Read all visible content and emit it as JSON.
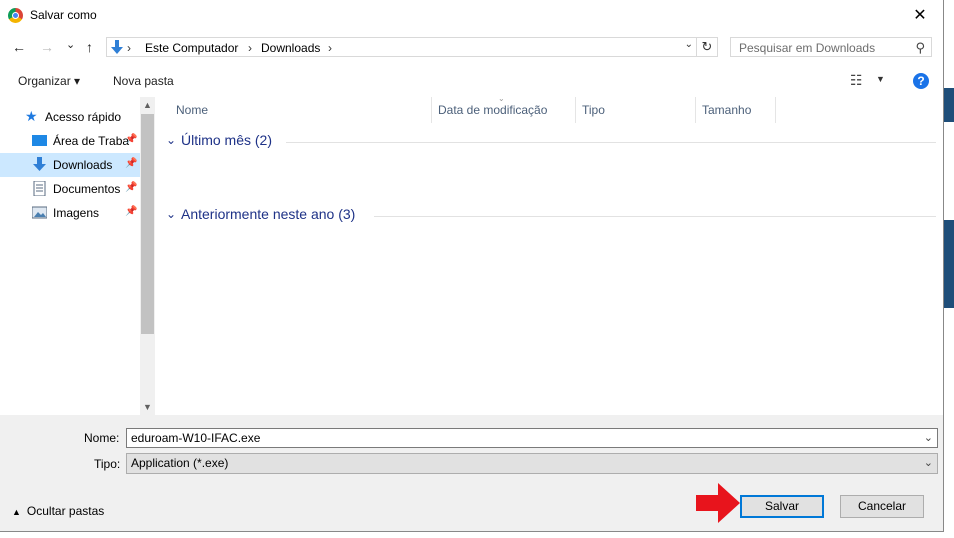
{
  "window": {
    "title": "Salvar como",
    "close_glyph": "✕"
  },
  "nav": {
    "back": "←",
    "forward": "→",
    "recent": "⌄",
    "up": "↑",
    "breadcrumbs": [
      "Este Computador",
      "Downloads"
    ],
    "separator": "›",
    "refresh": "↻",
    "search_placeholder": "Pesquisar em Downloads"
  },
  "toolbar": {
    "organize": "Organizar ▾",
    "new_folder": "Nova pasta",
    "help": "?"
  },
  "sidebar": {
    "items": [
      {
        "label": "Acesso rápido",
        "icon": "star-icon",
        "pinned": false
      },
      {
        "label": "Área de Traba",
        "icon": "desktop-icon",
        "pinned": true
      },
      {
        "label": "Downloads",
        "icon": "download-icon",
        "pinned": true,
        "selected": true
      },
      {
        "label": "Documentos",
        "icon": "document-icon",
        "pinned": true
      },
      {
        "label": "Imagens",
        "icon": "image-icon",
        "pinned": true
      }
    ]
  },
  "columns": [
    "Nome",
    "Data de modificação",
    "Tipo",
    "Tamanho"
  ],
  "groups": [
    {
      "label": "Último mês (2)"
    },
    {
      "label": "Anteriormente neste ano (3)"
    }
  ],
  "form": {
    "name_label": "Nome:",
    "name_value": "eduroam-W10-IFAC.exe",
    "type_label": "Tipo:",
    "type_value": "Application (*.exe)"
  },
  "footer": {
    "hide_folders": "Ocultar pastas",
    "save": "Salvar",
    "cancel": "Cancelar"
  },
  "colors": {
    "accent": "#0078d7",
    "selected_bg": "#cce8ff",
    "group_text": "#1e3287",
    "arrow": "#e8141c"
  }
}
